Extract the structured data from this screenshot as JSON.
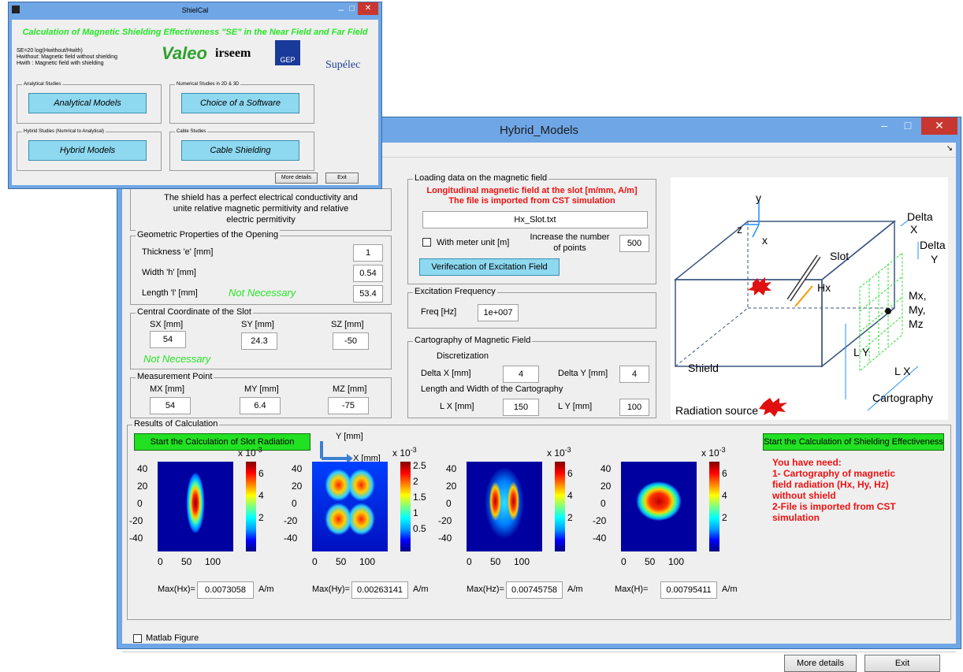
{
  "colors": {
    "title_green": "#26e626",
    "red_text": "#ee1111",
    "button_green": "#22e022",
    "button_cyan": "#8ed8f0",
    "window_frame": "#6fa6e6"
  },
  "main_window": {
    "title": "Hybrid_Models",
    "shield_text": "The shield has a perfect electrical conductivity and unite relative magnetic permitivity and relative electric permitivity",
    "geometric": {
      "title": "Geometric Properties of the Opening",
      "thickness_label": "Thickness  'e'  [mm]",
      "thickness_value": "1",
      "width_label": "Width      'h'  [mm]",
      "width_value": "0.54",
      "length_label": "Length     'l'  [mm]",
      "length_value": "53.4",
      "not_necessary": "Not Necessary"
    },
    "central": {
      "title": "Central Coordinate of the Slot",
      "sx_label": "SX  [mm]",
      "sx_value": "54",
      "sy_label": "SY  [mm]",
      "sy_value": "24.3",
      "sz_label": "SZ  [mm]",
      "sz_value": "-50",
      "not_necessary": "Not Necessary"
    },
    "measurement": {
      "title": "Measurement Point",
      "mx_label": "MX  [mm]",
      "mx_value": "54",
      "my_label": "MY  [mm]",
      "my_value": "6.4",
      "mz_label": "MZ  [mm]",
      "mz_value": "-75"
    },
    "loading": {
      "title": "Loading data on the magnetic field",
      "red_line1": "Longitudinal magnetic field at the slot [m/mm, A/m]",
      "red_line2": "The file is imported from CST simulation",
      "file_value": "Hx_Slot.txt",
      "meter_checkbox_label": "With meter unit [m]",
      "increase_label": "Increase the number of points",
      "increase_value": "500",
      "verify_button": "Verifecation of Excitation Field"
    },
    "excitation": {
      "title": "Excitation Frequency",
      "freq_label": "Freq [Hz]",
      "freq_value": "1e+007"
    },
    "cartography": {
      "title": "Cartography of Magnetic Field",
      "discretization": "Discretization",
      "dx_label": "Delta X  [mm]",
      "dx_value": "4",
      "dy_label": "Delta Y  [mm]",
      "dy_value": "4",
      "lw_label": "Length and Width of the Cartography",
      "lx_label": "L X  [mm]",
      "lx_value": "150",
      "ly_label": "L Y   [mm]",
      "ly_value": "100"
    },
    "diagram": {
      "y": "y",
      "z": "z",
      "x": "x",
      "slot": "Slot",
      "hx": "Hx",
      "delta_x1": "Delta",
      "delta_x2": "X",
      "delta_y1": "Delta",
      "delta_y2": "Y",
      "mx": "Mx,",
      "my": "My,",
      "mz": "Mz",
      "ly": "L Y",
      "lx": "L X",
      "shield": "Shield",
      "cartography": "Cartography",
      "radiation_source": "Radiation source"
    },
    "results": {
      "title": "Results of Calculation",
      "start_slot_button": "Start the Calculation of Slot Radiation",
      "start_se_button": "Start the Calculation of Shielding Effectiveness",
      "axis_y": "Y [mm]",
      "axis_x": "X [mm]",
      "need_text": [
        "You have need:",
        "1- Cartography of magnetic",
        "field radiation (Hx, Hy, Hz)",
        "without shield",
        "2-File is imported from CST",
        "simulation"
      ],
      "plots": [
        {
          "exp": "x 10",
          "exp_pow": "-3",
          "cbar_ticks": [
            "6",
            "4",
            "2"
          ],
          "max_label": "Max(Hx)=",
          "max_value": "0.0073058",
          "unit": "A/m"
        },
        {
          "exp": "x 10",
          "exp_pow": "-3",
          "cbar_ticks": [
            "2.5",
            "2",
            "1.5",
            "1",
            "0.5"
          ],
          "max_label": "Max(Hy)=",
          "max_value": "0.00263141",
          "unit": "A/m"
        },
        {
          "exp": "x 10",
          "exp_pow": "-3",
          "cbar_ticks": [
            "6",
            "4",
            "2"
          ],
          "max_label": "Max(Hz)=",
          "max_value": "0.00745758",
          "unit": "A/m"
        },
        {
          "exp": "x 10",
          "exp_pow": "-3",
          "cbar_ticks": [
            "6",
            "4",
            "2"
          ],
          "max_label": "Max(H)=",
          "max_value": "0.00795411",
          "unit": "A/m"
        }
      ],
      "y_ticks": [
        "40",
        "20",
        "0",
        "-20",
        "-40"
      ],
      "x_ticks": [
        "0",
        "50",
        "100"
      ]
    },
    "matlab_checkbox": "Matlab Figure",
    "more_details": "More details",
    "exit": "Exit"
  },
  "shielcal": {
    "title": "ShielCal",
    "headline": "Calculation of Magnetic Shielding Effectiveness \"SE\" in the Near Field and Far Field",
    "formula1": "SE=20 log(Hwithout/Hwith)",
    "formula2": "Hwithout:  Magnetic field without shielding",
    "formula3": "Hwith  :    Magnetic field with shielding",
    "logo_valeo": "Valeo",
    "logo_irseem": "irseem",
    "logo_gep": "GEP",
    "logo_supelec": "Supélec",
    "analytical_studies": "Analytical Studies",
    "analytical_button": "Analytical Models",
    "numerical_studies": "Numerical Studies in 2D & 3D",
    "software_button": "Choice of a Software",
    "hybrid_studies": "Hybrid Studies (Numrical to Analytical)",
    "hybrid_button": "Hybrid Models",
    "cable_studies": "Cable Studies",
    "cable_button": "Cable Shielding",
    "more_details": "More details",
    "exit": "Exit"
  }
}
